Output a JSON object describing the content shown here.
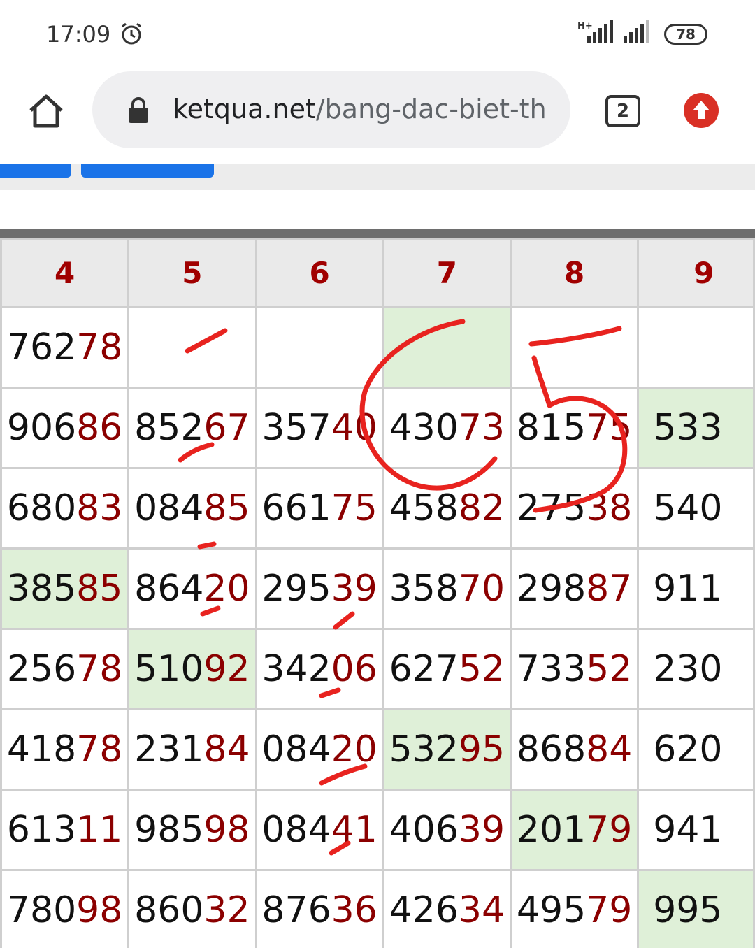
{
  "status_bar": {
    "time": "17:09",
    "network": "H+",
    "battery": "78"
  },
  "browser": {
    "url_host": "ketqua.net",
    "url_path": "/bang-dac-biet-th",
    "tab_count": "2"
  },
  "table": {
    "headers": [
      "4",
      "5",
      "6",
      "7",
      "8",
      "9"
    ],
    "rows": [
      [
        {
          "p": "762",
          "s": "78",
          "hl": false
        },
        {
          "p": "",
          "s": "",
          "hl": false
        },
        {
          "p": "",
          "s": "",
          "hl": false
        },
        {
          "p": "",
          "s": "",
          "hl": true
        },
        {
          "p": "",
          "s": "",
          "hl": false
        },
        {
          "p": "",
          "s": "",
          "hl": false
        }
      ],
      [
        {
          "p": "906",
          "s": "86",
          "hl": false
        },
        {
          "p": "852",
          "s": "67",
          "hl": false
        },
        {
          "p": "357",
          "s": "40",
          "hl": false
        },
        {
          "p": "430",
          "s": "73",
          "hl": false
        },
        {
          "p": "815",
          "s": "75",
          "hl": false
        },
        {
          "p": "533",
          "s": "",
          "hl": true
        }
      ],
      [
        {
          "p": "680",
          "s": "83",
          "hl": false
        },
        {
          "p": "084",
          "s": "85",
          "hl": false
        },
        {
          "p": "661",
          "s": "75",
          "hl": false
        },
        {
          "p": "458",
          "s": "82",
          "hl": false
        },
        {
          "p": "275",
          "s": "38",
          "hl": false
        },
        {
          "p": "540",
          "s": "",
          "hl": false
        }
      ],
      [
        {
          "p": "385",
          "s": "85",
          "hl": true
        },
        {
          "p": "864",
          "s": "20",
          "hl": false
        },
        {
          "p": "295",
          "s": "39",
          "hl": false
        },
        {
          "p": "358",
          "s": "70",
          "hl": false
        },
        {
          "p": "298",
          "s": "87",
          "hl": false
        },
        {
          "p": "911",
          "s": "",
          "hl": false
        }
      ],
      [
        {
          "p": "256",
          "s": "78",
          "hl": false
        },
        {
          "p": "510",
          "s": "92",
          "hl": true
        },
        {
          "p": "342",
          "s": "06",
          "hl": false
        },
        {
          "p": "627",
          "s": "52",
          "hl": false
        },
        {
          "p": "733",
          "s": "52",
          "hl": false
        },
        {
          "p": "230",
          "s": "",
          "hl": false
        }
      ],
      [
        {
          "p": "418",
          "s": "78",
          "hl": false
        },
        {
          "p": "231",
          "s": "84",
          "hl": false
        },
        {
          "p": "084",
          "s": "20",
          "hl": false
        },
        {
          "p": "532",
          "s": "95",
          "hl": true
        },
        {
          "p": "868",
          "s": "84",
          "hl": false
        },
        {
          "p": "620",
          "s": "",
          "hl": false
        }
      ],
      [
        {
          "p": "613",
          "s": "11",
          "hl": false
        },
        {
          "p": "985",
          "s": "98",
          "hl": false
        },
        {
          "p": "084",
          "s": "41",
          "hl": false
        },
        {
          "p": "406",
          "s": "39",
          "hl": false
        },
        {
          "p": "201",
          "s": "79",
          "hl": true
        },
        {
          "p": "941",
          "s": "",
          "hl": false
        }
      ],
      [
        {
          "p": "780",
          "s": "98",
          "hl": false
        },
        {
          "p": "860",
          "s": "32",
          "hl": false
        },
        {
          "p": "876",
          "s": "36",
          "hl": false
        },
        {
          "p": "426",
          "s": "34",
          "hl": false
        },
        {
          "p": "495",
          "s": "79",
          "hl": false
        },
        {
          "p": "995",
          "s": "",
          "hl": true
        }
      ]
    ]
  },
  "annotation": {
    "color": "#e8231f",
    "drawn_number": "5"
  }
}
